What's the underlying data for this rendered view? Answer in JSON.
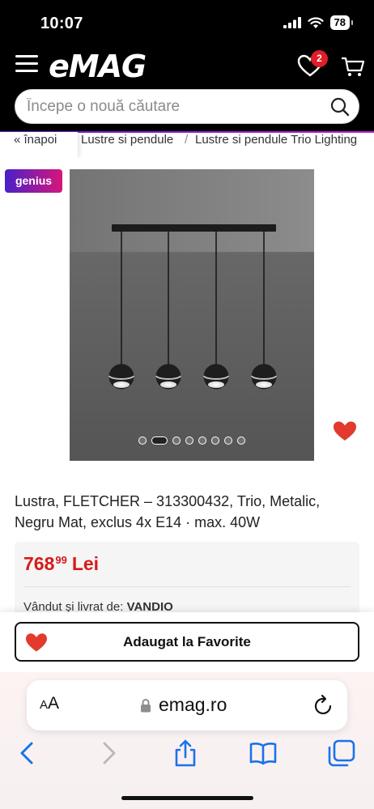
{
  "status_bar": {
    "time": "10:07",
    "battery": "78"
  },
  "header": {
    "logo": "eMAG",
    "favorites_count": "2"
  },
  "search": {
    "placeholder": "Începe o nouă căutare"
  },
  "breadcrumb": {
    "back": "« înapoi",
    "items": [
      "Lustre si pendule",
      "Lustre si pendule Trio Lighting"
    ],
    "separator": "/"
  },
  "product": {
    "badge": "genius",
    "title": "Lustra, FLETCHER – 313300432, Trio, Metalic, Negru Mat, exclus 4x E14 · max. 40W",
    "gallery": {
      "count": 8,
      "active_index": 1
    },
    "price": {
      "integer": "768",
      "decimals": "99",
      "currency": "Lei"
    },
    "seller": {
      "label": "Vândut și livrat de:",
      "name": "VANDIO"
    }
  },
  "cta": {
    "favorite_label": "Adaugat la Favorite"
  },
  "browser": {
    "aa_label_large": "A",
    "aa_label_small": "A",
    "domain": "emag.ro"
  },
  "colors": {
    "brand_black": "#000000",
    "price_red": "#d71a1a",
    "badge_red": "#e11d2a",
    "ios_blue": "#1a73e8",
    "heart": "#e23a2c"
  }
}
